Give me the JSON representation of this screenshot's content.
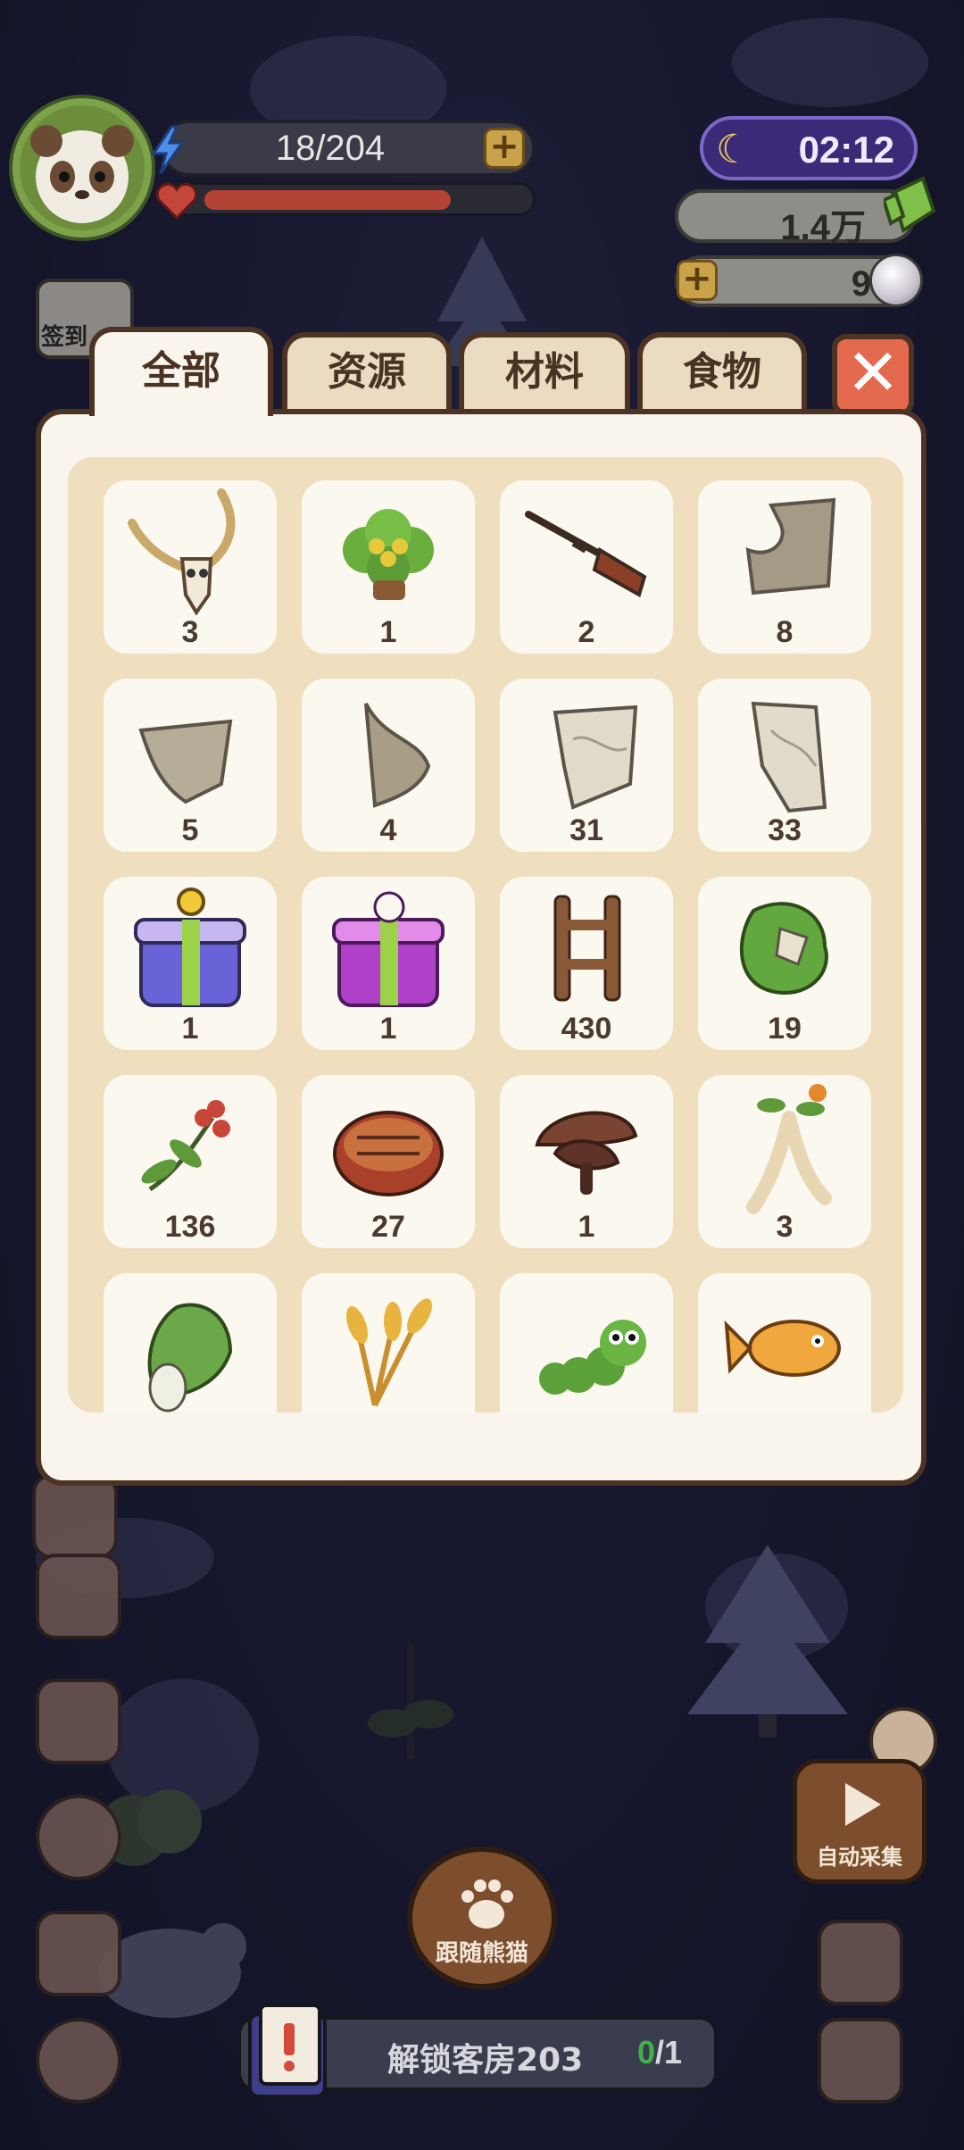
{
  "hud": {
    "energy": "18/204",
    "time": "02:12",
    "coins": "1.4万",
    "gems": "9",
    "checkin_label": "签到",
    "health_fraction": 0.78
  },
  "inventory": {
    "tabs": [
      {
        "label": "全部",
        "active": true
      },
      {
        "label": "资源",
        "active": false
      },
      {
        "label": "材料",
        "active": false
      },
      {
        "label": "食物",
        "active": false
      }
    ],
    "close_icon": "close-icon",
    "items": [
      {
        "icon": "bull-skull-icon",
        "count": "3"
      },
      {
        "icon": "herb-pot-icon",
        "count": "1"
      },
      {
        "icon": "hunting-rifle-icon",
        "count": "2"
      },
      {
        "icon": "map-piece-icon",
        "count": "8"
      },
      {
        "icon": "map-fragment-icon",
        "count": "5"
      },
      {
        "icon": "map-fragment-icon",
        "count": "4"
      },
      {
        "icon": "map-fragment-icon",
        "count": "31"
      },
      {
        "icon": "map-fragment-icon",
        "count": "33"
      },
      {
        "icon": "gift-box-key-icon",
        "count": "1"
      },
      {
        "icon": "gift-box-bunny-icon",
        "count": "1"
      },
      {
        "icon": "ladder-icon",
        "count": "430"
      },
      {
        "icon": "moss-block-icon",
        "count": "19"
      },
      {
        "icon": "berry-branch-icon",
        "count": "136"
      },
      {
        "icon": "grilled-meat-icon",
        "count": "27"
      },
      {
        "icon": "mushroom-icon",
        "count": "1"
      },
      {
        "icon": "ginseng-icon",
        "count": "3"
      },
      {
        "icon": "bok-choy-icon",
        "count": ""
      },
      {
        "icon": "wheat-icon",
        "count": ""
      },
      {
        "icon": "caterpillar-icon",
        "count": ""
      },
      {
        "icon": "fish-icon",
        "count": ""
      }
    ]
  },
  "bottom": {
    "follow_label": "跟随熊猫",
    "auto_label": "自动采集",
    "quest_text": "解锁客房203",
    "quest_done": "0",
    "quest_total": "/1"
  },
  "colors": {
    "panel": "#f9f5ec",
    "grid_bg": "#efdfbe",
    "border": "#4c3324",
    "close": "#e36a4e"
  }
}
